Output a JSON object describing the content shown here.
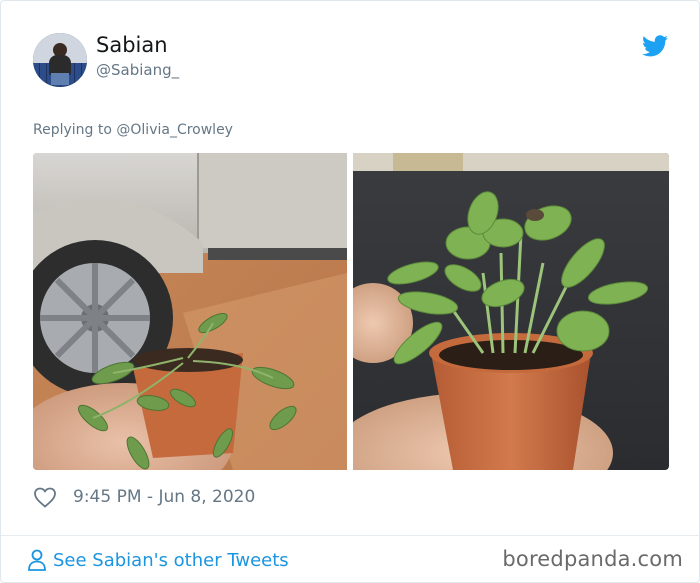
{
  "tweet": {
    "author": {
      "display_name": "Sabian",
      "handle": "@Sabiang_",
      "avatar_icon": "person-on-rooftop-avatar"
    },
    "brand_icon": "twitter-bird-icon",
    "brand_color": "#1da1f2",
    "replying_prefix": "Replying to",
    "replying_to": "@Olivia_Crowley",
    "media": [
      {
        "subject": "wilted seedlings in small terracotta pot held near a silver car tire"
      },
      {
        "subject": "healthy green seedlings in small terracotta pot held over dark table"
      }
    ],
    "like_icon": "heart-outline-icon",
    "timestamp": "9:45 PM - Jun 8, 2020",
    "footer": {
      "see_more_icon": "person-outline-icon",
      "see_more_label": "See Sabian's other Tweets",
      "link_color": "#1b95e0"
    }
  },
  "watermark": "boredpanda.com"
}
